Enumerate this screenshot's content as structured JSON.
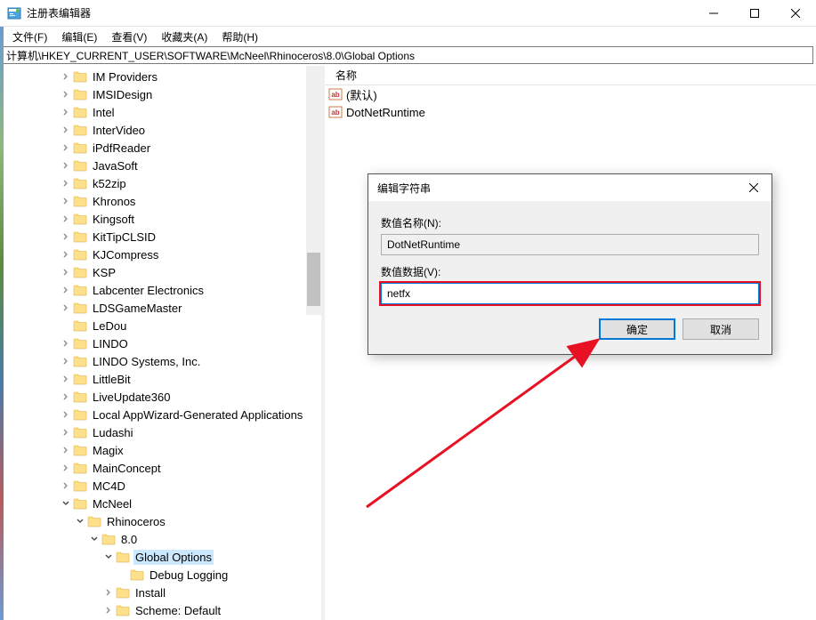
{
  "window": {
    "title": "注册表编辑器"
  },
  "menu": {
    "file": "文件(F)",
    "edit": "编辑(E)",
    "view": "查看(V)",
    "favorites": "收藏夹(A)",
    "help": "帮助(H)"
  },
  "address": "计算机\\HKEY_CURRENT_USER\\SOFTWARE\\McNeel\\Rhinoceros\\8.0\\Global Options",
  "tree": [
    {
      "label": "IM Providers",
      "indent": 3,
      "chevron": "right"
    },
    {
      "label": "IMSIDesign",
      "indent": 3,
      "chevron": "right"
    },
    {
      "label": "Intel",
      "indent": 3,
      "chevron": "right"
    },
    {
      "label": "InterVideo",
      "indent": 3,
      "chevron": "right"
    },
    {
      "label": "iPdfReader",
      "indent": 3,
      "chevron": "right"
    },
    {
      "label": "JavaSoft",
      "indent": 3,
      "chevron": "right"
    },
    {
      "label": "k52zip",
      "indent": 3,
      "chevron": "right"
    },
    {
      "label": "Khronos",
      "indent": 3,
      "chevron": "right"
    },
    {
      "label": "Kingsoft",
      "indent": 3,
      "chevron": "right"
    },
    {
      "label": "KitTipCLSID",
      "indent": 3,
      "chevron": "right"
    },
    {
      "label": "KJCompress",
      "indent": 3,
      "chevron": "right"
    },
    {
      "label": "KSP",
      "indent": 3,
      "chevron": "right"
    },
    {
      "label": "Labcenter Electronics",
      "indent": 3,
      "chevron": "right"
    },
    {
      "label": "LDSGameMaster",
      "indent": 3,
      "chevron": "right"
    },
    {
      "label": "LeDou",
      "indent": 3,
      "chevron": "none"
    },
    {
      "label": "LINDO",
      "indent": 3,
      "chevron": "right"
    },
    {
      "label": "LINDO Systems, Inc.",
      "indent": 3,
      "chevron": "right"
    },
    {
      "label": "LittleBit",
      "indent": 3,
      "chevron": "right"
    },
    {
      "label": "LiveUpdate360",
      "indent": 3,
      "chevron": "right"
    },
    {
      "label": "Local AppWizard-Generated Applications",
      "indent": 3,
      "chevron": "right"
    },
    {
      "label": "Ludashi",
      "indent": 3,
      "chevron": "right"
    },
    {
      "label": "Magix",
      "indent": 3,
      "chevron": "right"
    },
    {
      "label": "MainConcept",
      "indent": 3,
      "chevron": "right"
    },
    {
      "label": "MC4D",
      "indent": 3,
      "chevron": "right"
    },
    {
      "label": "McNeel",
      "indent": 3,
      "chevron": "down"
    },
    {
      "label": "Rhinoceros",
      "indent": 4,
      "chevron": "down"
    },
    {
      "label": "8.0",
      "indent": 5,
      "chevron": "down"
    },
    {
      "label": "Global Options",
      "indent": 6,
      "chevron": "down",
      "selected": true
    },
    {
      "label": "Debug Logging",
      "indent": 7,
      "chevron": "none"
    },
    {
      "label": "Install",
      "indent": 6,
      "chevron": "right"
    },
    {
      "label": "Scheme: Default",
      "indent": 6,
      "chevron": "right"
    }
  ],
  "list": {
    "header_name": "名称",
    "rows": [
      {
        "label": "(默认)"
      },
      {
        "label": "DotNetRuntime"
      }
    ]
  },
  "dialog": {
    "title": "编辑字符串",
    "name_label": "数值名称(N):",
    "name_value": "DotNetRuntime",
    "data_label": "数值数据(V):",
    "data_value": "netfx",
    "ok": "确定",
    "cancel": "取消"
  }
}
